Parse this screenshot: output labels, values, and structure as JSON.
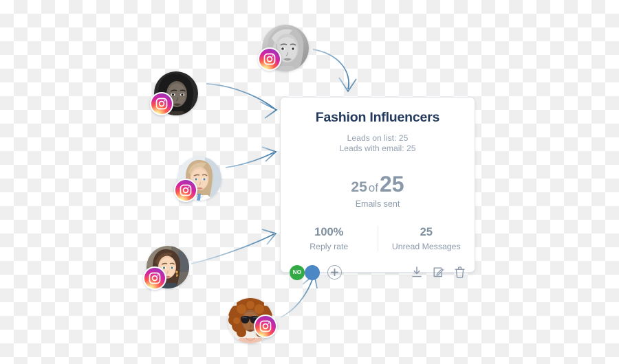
{
  "card": {
    "title": "Fashion Influencers",
    "leads_on_list": "Leads on list: 25",
    "leads_with_email": "Leads with email: 25",
    "emails": {
      "sent": "25",
      "of": "of",
      "total": "25",
      "label": "Emails sent"
    },
    "stats": [
      {
        "value": "100%",
        "label": "Reply rate"
      },
      {
        "value": "25",
        "label": "Unread Messages"
      }
    ],
    "actions": {
      "toggle_label": "NO",
      "add_icon": "plus-icon",
      "download_icon": "download-icon",
      "edit_icon": "edit-pencil-icon",
      "delete_icon": "trash-icon"
    },
    "colors": {
      "title": "#23395b",
      "muted_text": "#8a99aa",
      "border": "#dfe4ea",
      "toggle_on": "#34aa44",
      "toggle_off": "#4a87c4"
    }
  },
  "avatars": [
    {
      "name": "influencer-avatar-1",
      "badge": "instagram-icon",
      "description": "grayscale portrait"
    },
    {
      "name": "influencer-avatar-2",
      "badge": "instagram-icon",
      "description": "dark grayscale portrait"
    },
    {
      "name": "influencer-avatar-3",
      "badge": "instagram-icon",
      "description": "color portrait light blue"
    },
    {
      "name": "influencer-avatar-4",
      "badge": "instagram-icon",
      "description": "color portrait warm tones"
    },
    {
      "name": "influencer-avatar-5",
      "badge": "instagram-icon",
      "description": "curly hair portrait with sunglasses"
    }
  ],
  "arrows": {
    "color": "#5b8fb9",
    "count": "5"
  }
}
